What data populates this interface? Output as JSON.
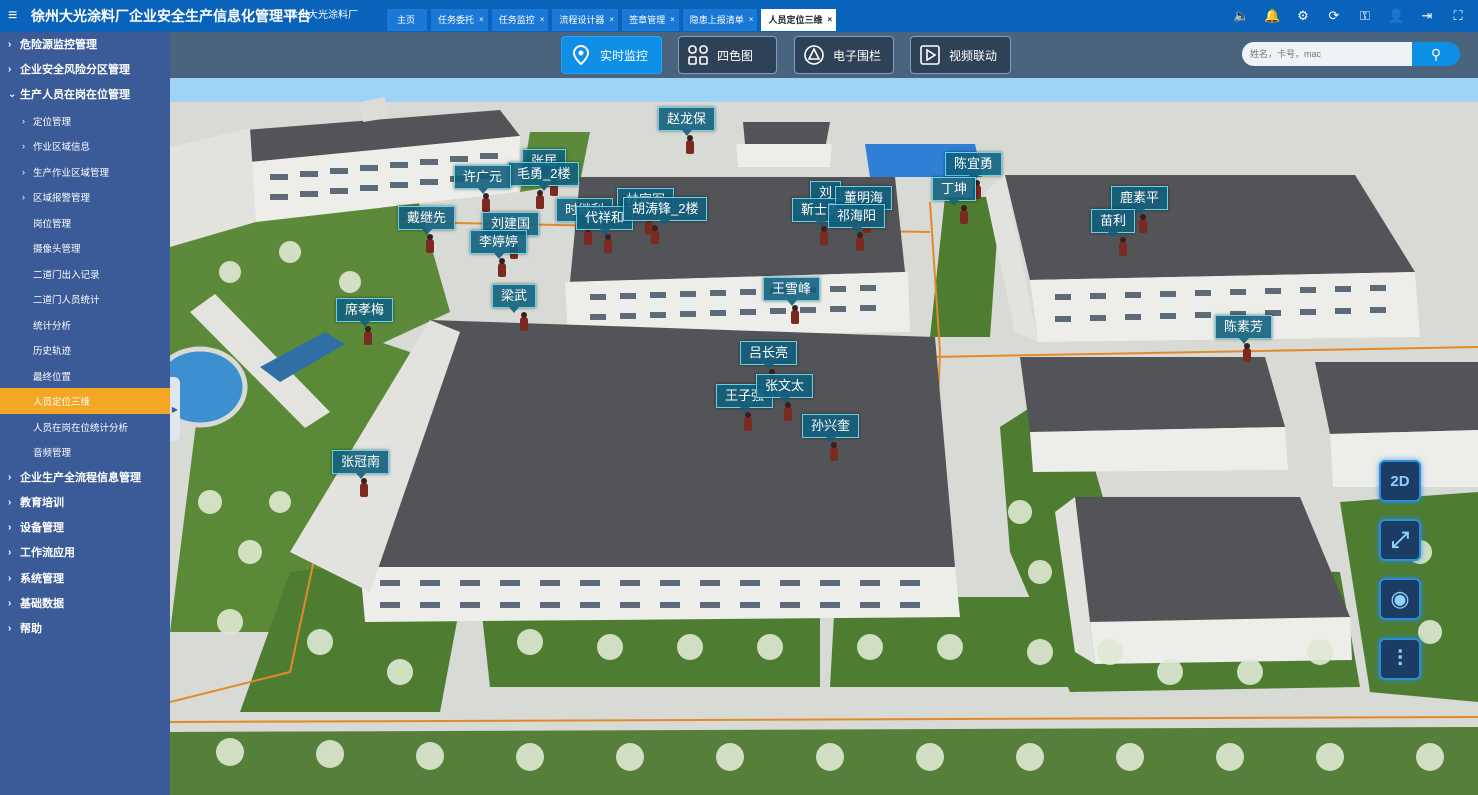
{
  "app": {
    "title": "徐州大光涂料厂企业安全生产信息化管理平台",
    "company": "徐州大光涂料厂"
  },
  "tabs": [
    {
      "label": "主页",
      "closable": false,
      "active": false
    },
    {
      "label": "任务委托",
      "closable": true,
      "active": false
    },
    {
      "label": "任务监控",
      "closable": true,
      "active": false
    },
    {
      "label": "流程设计器",
      "closable": true,
      "active": false
    },
    {
      "label": "签章管理",
      "closable": true,
      "active": false
    },
    {
      "label": "隐患上报清单",
      "closable": true,
      "active": false
    },
    {
      "label": "人员定位三维",
      "closable": true,
      "active": true
    }
  ],
  "tab_close_glyph": "×",
  "top_icons": [
    "volume-icon",
    "bell-icon",
    "settings-icon",
    "refresh-icon",
    "key-icon",
    "user-icon",
    "logout-icon",
    "fullscreen-icon"
  ],
  "sidebar": {
    "items": [
      {
        "label": "危险源监控管理",
        "level": "top",
        "expanded": false
      },
      {
        "label": "企业安全风险分区管理",
        "level": "top",
        "expanded": false
      },
      {
        "label": "生产人员在岗在位管理",
        "level": "top",
        "expanded": true
      },
      {
        "label": "定位管理",
        "level": "sub"
      },
      {
        "label": "作业区域信息",
        "level": "sub"
      },
      {
        "label": "生产作业区域管理",
        "level": "sub"
      },
      {
        "label": "区域报警管理",
        "level": "sub"
      },
      {
        "label": "岗位管理",
        "level": "leaf"
      },
      {
        "label": "摄像头管理",
        "level": "leaf"
      },
      {
        "label": "二道门出入记录",
        "level": "leaf"
      },
      {
        "label": "二道门人员统计",
        "level": "leaf"
      },
      {
        "label": "统计分析",
        "level": "leaf"
      },
      {
        "label": "历史轨迹",
        "level": "leaf"
      },
      {
        "label": "最终位置",
        "level": "leaf"
      },
      {
        "label": "人员定位三维",
        "level": "leaf",
        "active": true
      },
      {
        "label": "人员在岗在位统计分析",
        "level": "leaf"
      },
      {
        "label": "音频管理",
        "level": "leaf"
      },
      {
        "label": "企业生产全流程信息管理",
        "level": "top",
        "expanded": false
      },
      {
        "label": "教育培训",
        "level": "top",
        "expanded": false
      },
      {
        "label": "设备管理",
        "level": "top",
        "expanded": false
      },
      {
        "label": "工作流应用",
        "level": "top",
        "expanded": false
      },
      {
        "label": "系统管理",
        "level": "top",
        "expanded": false
      },
      {
        "label": "基础数据",
        "level": "top",
        "expanded": false
      },
      {
        "label": "帮助",
        "level": "top",
        "expanded": false
      }
    ]
  },
  "modes": [
    {
      "label": "实时监控",
      "icon": "location-pin-icon",
      "active": true
    },
    {
      "label": "四色图",
      "icon": "grid-icon",
      "active": false
    },
    {
      "label": "电子围栏",
      "icon": "fence-icon",
      "active": false
    },
    {
      "label": "视频联动",
      "icon": "video-icon",
      "active": false
    }
  ],
  "search": {
    "placeholder": "姓名，卡号，mac"
  },
  "people": [
    "赵龙保",
    "张居",
    "毛勇_2楼",
    "许广元",
    "时继利",
    "戴继先",
    "林家军",
    "刘建国",
    "代祥和",
    "胡涛锋_2楼",
    "李婷婷",
    "刘",
    "靳士勇",
    "董明海",
    "祁海阳",
    "陈宜勇",
    "丁坤",
    "鹿素平",
    "苗利",
    "王雪峰",
    "梁武",
    "席孝梅",
    "陈素芳",
    "吕长亮",
    "王子强",
    "张文太",
    "孙兴奎",
    "张冠南"
  ],
  "right_tools": [
    {
      "label": "2D",
      "icon": "2d-view-icon"
    },
    {
      "label": "",
      "icon": "expand-icon"
    },
    {
      "label": "",
      "icon": "eye-icon"
    },
    {
      "label": "",
      "icon": "sliders-icon"
    }
  ],
  "colors": {
    "topbar": "#0a63bb",
    "sidebar": "#3a5b98",
    "active_leaf": "#f5a623",
    "active_mode": "#0f8fe6",
    "label_bg": "#125f7d",
    "label_border": "#63d4ea"
  }
}
